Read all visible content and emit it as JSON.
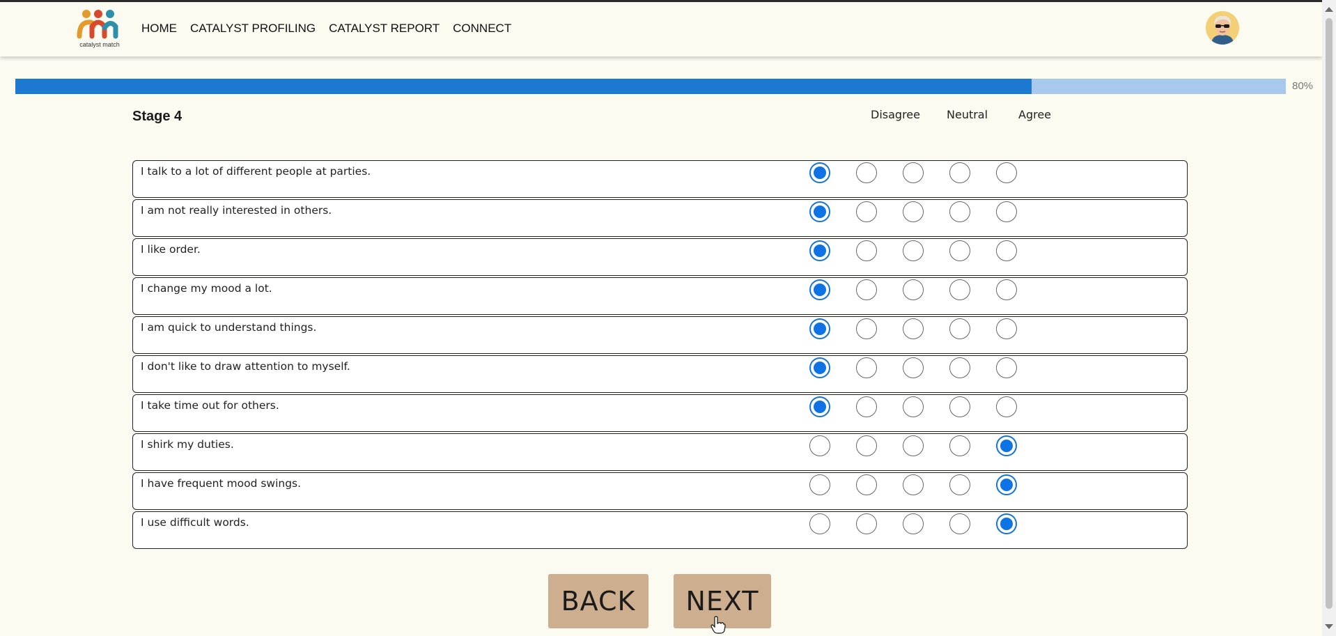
{
  "nav": {
    "logo_text": "catalyst match",
    "links": [
      "HOME",
      "CATALYST PROFILING",
      "CATALYST REPORT",
      "CONNECT"
    ]
  },
  "progress": {
    "percent": 80,
    "label": "80%"
  },
  "stage": {
    "title": "Stage 4"
  },
  "scale": {
    "disagree": "Disagree",
    "neutral": "Neutral",
    "agree": "Agree"
  },
  "questions": [
    {
      "text": "I talk to a lot of different people at parties.",
      "selected": 1
    },
    {
      "text": "I am not really interested in others.",
      "selected": 1
    },
    {
      "text": "I like order.",
      "selected": 1
    },
    {
      "text": "I change my mood a lot.",
      "selected": 1
    },
    {
      "text": "I am quick to understand things.",
      "selected": 1
    },
    {
      "text": "I don't like to draw attention to myself.",
      "selected": 1
    },
    {
      "text": "I take time out for others.",
      "selected": 1
    },
    {
      "text": "I shirk my duties.",
      "selected": 5
    },
    {
      "text": "I have frequent mood swings.",
      "selected": 5
    },
    {
      "text": "I use difficult words.",
      "selected": 5
    }
  ],
  "buttons": {
    "back": "BACK",
    "next": "NEXT"
  },
  "colors": {
    "accent": "#1b79d1",
    "progress_track": "#a8c9ec",
    "button": "#cdae8f",
    "background": "#fbfbf2"
  },
  "icons": {
    "logo": "catalyst-match-logo",
    "avatar": "user-avatar",
    "cursor": "hand-pointer"
  }
}
